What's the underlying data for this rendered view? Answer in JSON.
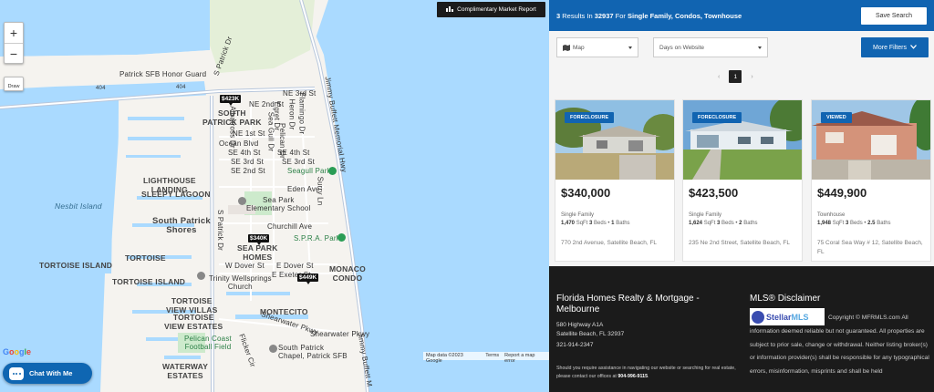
{
  "map": {
    "zoom_in": "+",
    "zoom_out": "−",
    "draw": "Draw",
    "report_button": "Complimentary Market Report",
    "google_letters": [
      "G",
      "o",
      "o",
      "g",
      "l",
      "e"
    ],
    "attribution": [
      "Map data ©2023 Google",
      "Terms",
      "Report a map error"
    ],
    "chat_button": "Chat With Me",
    "labels": {
      "honor_guard": "Patrick SFB Honor Guard",
      "south_patrick_park": "SOUTH\nPATRICK PARK",
      "lighthouse_landing": "LIGHTHOUSE\nLANDING",
      "sleepy_lagoon": "SLEEPY LAGOON",
      "nesbit_island": "Nesbit Island",
      "south_patrick_shores": "South Patrick\nShores",
      "tortoise": "TORTOISE",
      "tortoise_island_1": "TORTOISE ISLAND",
      "tortoise_island_2": "TORTOISE ISLAND",
      "tortoise_view_villas": "TORTOISE\nVIEW VILLAS",
      "tortoise_view_estates": "TORTOISE\nVIEW ESTATES",
      "waterway_estates": "WATERWAY\nESTATES",
      "sea_park_homes": "SEA PARK\nHOMES",
      "monaco_condo": "MONACO\nCONDO",
      "montecito": "MONTECITO",
      "sea_park_school": "Sea Park\nElementary School",
      "seagull_park": "Seagull Park",
      "spra_park": "S.P.R.A. Park",
      "trinity_church": "Trinity Wellsprings\nChurch",
      "pelican_field": "Pelican Coast\nFootball Field",
      "chapel": "South Patrick\nChapel, Patrick SFB",
      "ne_3rd": "NE 3rd St",
      "ne_2nd": "NE 2nd St",
      "ne_1st": "NE 1st St",
      "ocean_blvd": "Ocean Blvd",
      "se_4th": "SE 4th St",
      "se_3rd": "SE 3rd St",
      "se_2nd": "SE 2nd St",
      "se_4th_b": "SE 4th St",
      "se_3rd_b": "SE 3rd St",
      "eden_ave": "Eden Ave",
      "churchill_ave": "Churchill Ave",
      "e_dover": "E Dover St",
      "w_dover": "W Dover St",
      "e_exeter": "E Exeter St",
      "shearwater_pkwy": "Shearwater Pkwy",
      "shearwater_pkwy_2": "Shearwater Pkwy",
      "flicker_cir": "Flicker Cir",
      "s_patrick_dr": "S Patrick Dr",
      "s_patrick_dr_2": "S Patrick Dr",
      "jimmy_buffett": "Jimmy Buffett Memorial Hwy",
      "jimmy_buffett_2": "Jimmy Buffett M",
      "sea_gull_dr": "Sea Gull Dr",
      "pelican_dr": "Pelican Dr",
      "albatross_dr": "Albatross Dr",
      "flamingo_dr": "Flamingo Dr",
      "heron_dr": "Heron Dr",
      "egret_dr": "Egret Dr",
      "surry_ln": "Surry Ln",
      "rt404": "404",
      "rt404b": "404"
    },
    "pins": [
      "$423K",
      "$340K",
      "$449K"
    ]
  },
  "panel": {
    "results_count": "3",
    "results_text_1": "Results In",
    "zip": "32937",
    "results_text_2": "For",
    "property_types": "Single Family, Condos, Townhouse",
    "save_search": "Save Search",
    "view_select": "Map",
    "days_select": "Days on Website",
    "more_filters": "More Filters",
    "prev": "‹",
    "next": "›",
    "current_page": "1",
    "listings": [
      {
        "badge": "FORECLOSURE",
        "price": "$340,000",
        "type": "Single Family",
        "sqft": "1,470",
        "beds": "3",
        "baths": "1",
        "address": "770 2nd Avenue, Satellite Beach, FL"
      },
      {
        "badge": "FORECLOSURE",
        "price": "$423,500",
        "type": "Single Family",
        "sqft": "1,624",
        "beds": "3",
        "baths": "2",
        "address": "235 Ne 2nd Street, Satellite Beach, FL"
      },
      {
        "badge": "VIEWED",
        "price": "$449,900",
        "type": "Townhouse",
        "sqft": "1,948",
        "beds": "3",
        "baths": "2.5",
        "address": "75 Coral Sea Way # 12, Satellite Beach, FL"
      }
    ],
    "sqft_label": "SqFt",
    "beds_label": "Beds",
    "baths_label": "Baths",
    "footer": {
      "company": "Florida Homes Realty & Mortgage - Melbourne",
      "address_1": "580 Highway A1A",
      "address_2": "Satellite Beach, FL 32937",
      "phone": "321-914-2347",
      "note": "Should you require assistance in navigating our website or searching for real estate, please contact our offices at",
      "note_phone": "904-996-9115",
      "mls_title": "MLS® Disclaimer",
      "mls_logo_1": "Stellar",
      "mls_logo_2": "MLS",
      "mls_text": "Copyright © MFRMLS.com All information deemed reliable but not guaranteed. All properties are subject to prior sale, change or withdrawal. Neither listing broker(s) or information provider(s) shall be responsible for any typographical errors, misinformation, misprints and shall be held"
    }
  },
  "colors": {
    "accent": "#1164b1",
    "water": "#aadaff",
    "land": "#f5f3ef",
    "footer": "#1b1b1b"
  }
}
